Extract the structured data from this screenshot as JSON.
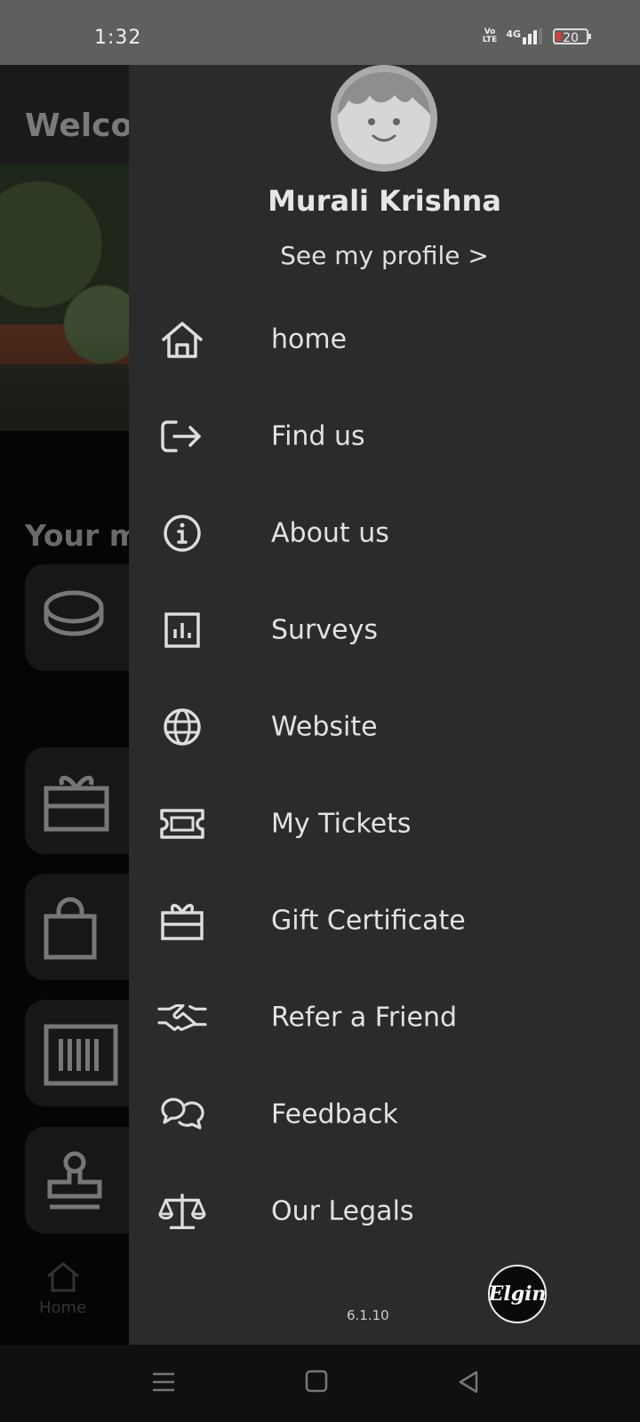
{
  "status_bar": {
    "time": "1:32",
    "volte": "Vo LTE",
    "network": "4G",
    "battery": "20"
  },
  "background_app": {
    "welcome": "Welco",
    "section_title": "Your m",
    "nav_home": "Home"
  },
  "drawer": {
    "user_name": "Murali Krishna",
    "see_profile": "See my profile >",
    "items": [
      {
        "label": "home",
        "icon": "home-icon"
      },
      {
        "label": "Find us",
        "icon": "sign-out-arrow-icon"
      },
      {
        "label": "About us",
        "icon": "info-icon"
      },
      {
        "label": "Surveys",
        "icon": "bar-chart-icon"
      },
      {
        "label": "Website",
        "icon": "globe-icon"
      },
      {
        "label": "My Tickets",
        "icon": "ticket-icon"
      },
      {
        "label": "Gift Certificate",
        "icon": "gift-icon"
      },
      {
        "label": "Refer a Friend",
        "icon": "handshake-icon"
      },
      {
        "label": "Feedback",
        "icon": "chat-bubbles-icon"
      },
      {
        "label": "Our Legals",
        "icon": "scales-icon"
      }
    ],
    "version": "6.1.10",
    "brand": "Elgin"
  },
  "colors": {
    "drawer_bg": "#2b2b2b",
    "status_bar_bg": "#5f5f5f",
    "text": "#e2e2e2",
    "battery_low": "#e23b3b"
  }
}
